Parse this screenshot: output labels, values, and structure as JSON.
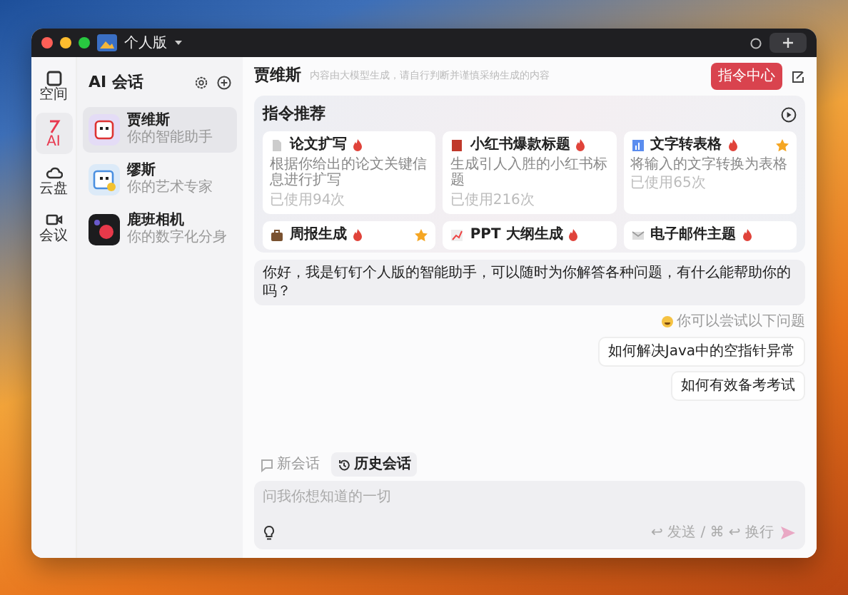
{
  "window": {
    "workspace": "个人版"
  },
  "rail": [
    {
      "label": "空间",
      "kind": "square",
      "selected": false
    },
    {
      "label": "AI",
      "kind": "ai",
      "selected": true
    },
    {
      "label": "云盘",
      "kind": "cloud",
      "selected": false
    },
    {
      "label": "会议",
      "kind": "video",
      "selected": false
    }
  ],
  "sessions": {
    "title": "AI 会话",
    "items": [
      {
        "name": "贾维斯",
        "subtitle": "你的智能助手",
        "kind": "robot",
        "selected": true
      },
      {
        "name": "缪斯",
        "subtitle": "你的艺术专家",
        "kind": "art",
        "selected": false
      },
      {
        "name": "鹿班相机",
        "subtitle": "你的数字化分身",
        "kind": "camera",
        "selected": false
      }
    ]
  },
  "header": {
    "title": "贾维斯",
    "subtitle": "内容由大模型生成，请自行判断并谨慎采纳生成的内容",
    "button": "指令中心"
  },
  "recommendations": {
    "title": "指令推荐",
    "cards": [
      {
        "kind": "doc",
        "title": "论文扩写",
        "hot": true,
        "starred": false,
        "description": "根据你给出的论文关键信息进行扩写",
        "usage": "已使用94次"
      },
      {
        "kind": "book",
        "title": "小红书爆款标题",
        "hot": true,
        "starred": false,
        "description": "生成引人入胜的小红书标题",
        "usage": "已使用216次"
      },
      {
        "kind": "chart",
        "title": "文字转表格",
        "hot": true,
        "starred": true,
        "description": "将输入的文字转换为表格",
        "usage": "已使用65次"
      },
      {
        "kind": "briefcase",
        "title": "周报生成",
        "hot": true,
        "starred": true
      },
      {
        "kind": "trend",
        "title": "PPT 大纲生成",
        "hot": true,
        "starred": false
      },
      {
        "kind": "mail",
        "title": "电子邮件主题",
        "hot": true,
        "starred": false
      }
    ]
  },
  "chat": {
    "greeting": "你好，我是钉钉个人版的智能助手，可以随时为你解答各种问题，有什么能帮助你的吗？",
    "hint": "你可以尝试以下问题",
    "suggestions": [
      "如何解决Java中的空指针异常",
      "如何有效备考考试"
    ]
  },
  "toolbar": [
    {
      "label": "新会话",
      "kind": "chat",
      "selected": false
    },
    {
      "label": "历史会话",
      "kind": "history",
      "selected": true
    }
  ],
  "input": {
    "placeholder": "问我你想知道的一切",
    "shortcut_hint": "↩ 发送 / ⌘ ↩ 换行"
  }
}
